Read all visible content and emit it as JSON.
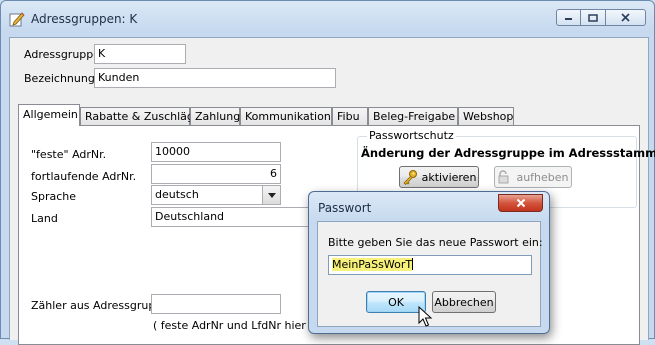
{
  "window": {
    "title": "Adressgruppen: K"
  },
  "header": {
    "adressgruppe_label": "Adressgruppe",
    "adressgruppe_value": "K",
    "bezeichnung_label": "Bezeichnung",
    "bezeichnung_value": "Kunden"
  },
  "tabs": [
    {
      "label": "Allgemein"
    },
    {
      "label": "Rabatte & Zuschläge"
    },
    {
      "label": "Zahlung"
    },
    {
      "label": "Kommunikation"
    },
    {
      "label": "Fibu"
    },
    {
      "label": "Beleg-Freigabe"
    },
    {
      "label": "Webshop"
    }
  ],
  "allgemein": {
    "feste_adrnr_label": "\"feste\" AdrNr.",
    "feste_adrnr_value": "10000",
    "fortlaufende_label": "fortlaufende AdrNr.",
    "fortlaufende_value": "6",
    "sprache_label": "Sprache",
    "sprache_value": "deutsch",
    "land_label": "Land",
    "land_value": "Deutschland",
    "zaehler_label": "Zähler aus Adressgruppe",
    "zaehler_value": "",
    "hint": "( feste AdrNr und LfdNr hier ohne"
  },
  "passwortschutz": {
    "legend": "Passwortschutz",
    "heading": "Änderung der Adressgruppe im Adressstamm",
    "aktivieren_label": "aktivieren",
    "aufheben_label": "aufheben"
  },
  "dialog": {
    "title": "Passwort",
    "prompt": "Bitte geben Sie das neue Passwort ein:",
    "password_value": "MeinPaSsWorT",
    "ok_label": "OK",
    "cancel_label": "Abbrechen"
  },
  "colors": {
    "password_highlight": "#f7f07a",
    "group_heading": "#000000"
  }
}
